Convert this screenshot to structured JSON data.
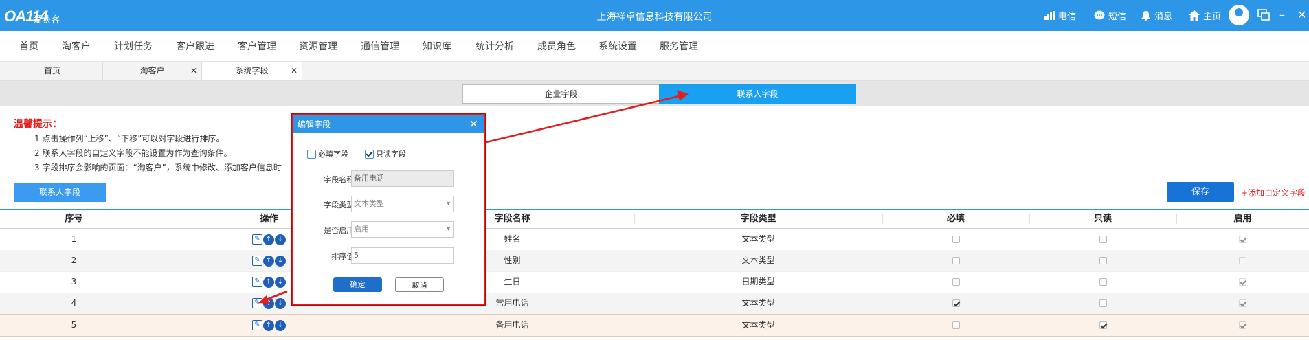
{
  "topbar": {
    "logo": "OA114",
    "logo_sub": "爱获客",
    "company": "上海祥卓信息科技有限公司",
    "items": [
      {
        "label": "电信",
        "icon": "signal-icon"
      },
      {
        "label": "短信",
        "icon": "chat-icon"
      },
      {
        "label": "消息",
        "icon": "bell-icon"
      },
      {
        "label": "主页",
        "icon": "home-icon"
      }
    ],
    "minimize": "–",
    "close": "✕"
  },
  "menu": [
    "首页",
    "淘客户",
    "计划任务",
    "客户跟进",
    "客户管理",
    "资源管理",
    "通信管理",
    "知识库",
    "统计分析",
    "成员角色",
    "系统设置",
    "服务管理"
  ],
  "tabs": [
    {
      "label": "首页",
      "closable": false
    },
    {
      "label": "淘客户",
      "closable": true
    },
    {
      "label": "系统字段",
      "closable": true
    }
  ],
  "segments": {
    "left": "企业字段",
    "right": "联系人字段"
  },
  "tips": {
    "title": "温馨提示：",
    "lines": [
      "1.点击操作列“上移”、“下移”可以对字段进行排序。",
      "2.联系人字段的自定义字段不能设置为作为查询条件。",
      "3.字段排序会影响的页面：“淘客户”，系统中修改、添加客户信息时"
    ]
  },
  "buttons": {
    "contact_fields": "联系人字段",
    "save": "保存",
    "add_custom": "+添加自定义字段"
  },
  "table": {
    "headers": [
      "序号",
      "操作",
      "字段名称",
      "字段类型",
      "必填",
      "只读",
      "启用"
    ],
    "rows": [
      {
        "no": "1",
        "name": "姓名",
        "type": "文本类型",
        "required": false,
        "readonly": false,
        "enabled": true
      },
      {
        "no": "2",
        "name": "性别",
        "type": "文本类型",
        "required": false,
        "readonly": false,
        "enabled": false
      },
      {
        "no": "3",
        "name": "生日",
        "type": "日期类型",
        "required": false,
        "readonly": false,
        "enabled": true
      },
      {
        "no": "4",
        "name": "常用电话",
        "type": "文本类型",
        "required": true,
        "readonly": false,
        "enabled": true
      },
      {
        "no": "5",
        "name": "备用电话",
        "type": "文本类型",
        "required": false,
        "readonly": true,
        "enabled": true
      }
    ]
  },
  "modal": {
    "title": "编辑字段",
    "close": "✕",
    "required_label": "必填字段",
    "readonly_label": "只读字段",
    "required_checked": false,
    "readonly_checked": true,
    "field_name_label": "字段名称:",
    "field_name_value": "备用电话",
    "field_type_label": "字段类型:",
    "field_type_value": "文本类型",
    "enabled_label": "是否启用:",
    "enabled_value": "启用",
    "sort_label": "排序值:",
    "sort_value": "5",
    "ok": "确定",
    "cancel": "取消"
  },
  "colors": {
    "primary": "#2d96e6",
    "accent": "#1aa0f0",
    "danger": "#e01e1e"
  }
}
